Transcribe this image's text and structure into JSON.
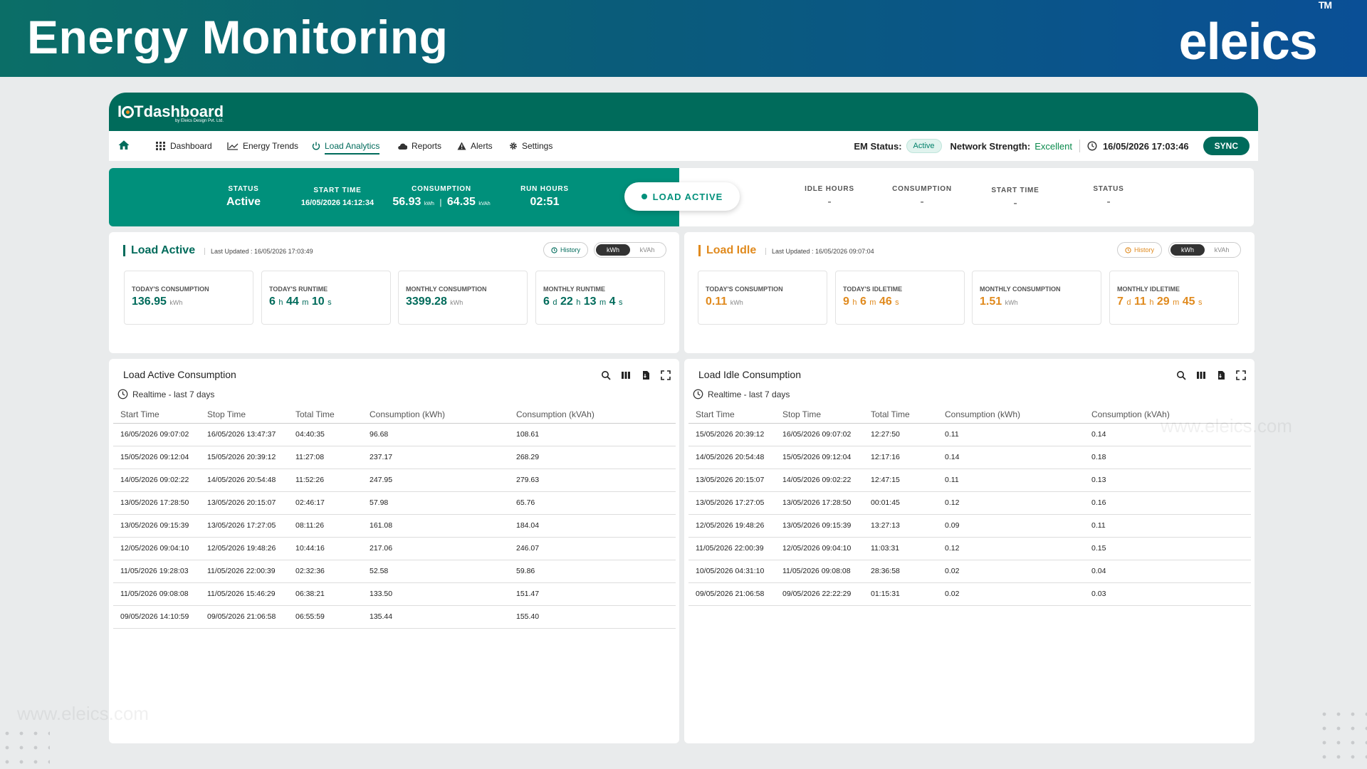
{
  "banner": {
    "title": "Energy Monitoring",
    "brand": "eleics",
    "brand_tm": "TM"
  },
  "app": {
    "logo_main": "Tdashboard",
    "logo_prefix": "I",
    "logo_sub": "by Eleics Design Pvt. Ltd."
  },
  "nav": {
    "items": [
      "Dashboard",
      "Energy Trends",
      "Load Analytics",
      "Reports",
      "Alerts",
      "Settings"
    ],
    "active": "Load Analytics",
    "em_status_label": "EM Status:",
    "em_status_value": "Active",
    "network_label": "Network Strength:",
    "network_value": "Excellent",
    "datetime": "16/05/2026 17:03:46",
    "sync": "SYNC"
  },
  "strip": {
    "active": {
      "status_k": "STATUS",
      "status_v": "Active",
      "start_k": "START TIME",
      "start_v": "16/05/2026 14:12:34",
      "cons_k": "CONSUMPTION",
      "cons_kwh": "56.93",
      "cons_kwh_unit": "kWh",
      "cons_sep": "|",
      "cons_kvah": "64.35",
      "cons_kvah_unit": "kVAh",
      "run_k": "RUN HOURS",
      "run_v": "02:51"
    },
    "load_active_btn": "LOAD ACTIVE",
    "idle": {
      "idle_k": "IDLE HOURS",
      "idle_v": "-",
      "cons_k": "CONSUMPTION",
      "cons_v": "-",
      "start_k": "START TIME",
      "start_v": "-",
      "status_k": "STATUS",
      "status_v": "-"
    }
  },
  "summary_active": {
    "title": "Load Active",
    "updated": "Last Updated : 16/05/2026 17:03:49",
    "history": "History",
    "unit_kwh": "kWh",
    "unit_kvah": "kVAh",
    "cards": [
      {
        "label": "TODAY'S CONSUMPTION",
        "value": "136.95",
        "unit": "kWh"
      },
      {
        "label": "TODAY'S RUNTIME",
        "d": "",
        "h": "6",
        "m": "44",
        "s": "10"
      },
      {
        "label": "MONTHLY CONSUMPTION",
        "value": "3399.28",
        "unit": "kWh"
      },
      {
        "label": "MONTHLY RUNTIME",
        "d": "6",
        "h": "22",
        "m": "13",
        "s": "4"
      }
    ]
  },
  "summary_idle": {
    "title": "Load Idle",
    "updated": "Last Updated : 16/05/2026 09:07:04",
    "history": "History",
    "unit_kwh": "kWh",
    "unit_kvah": "kVAh",
    "cards": [
      {
        "label": "TODAY'S CONSUMPTION",
        "value": "0.11",
        "unit": "kWh"
      },
      {
        "label": "TODAY'S IDLETIME",
        "d": "",
        "h": "9",
        "m": "6",
        "s": "46"
      },
      {
        "label": "MONTHLY CONSUMPTION",
        "value": "1.51",
        "unit": "kWh"
      },
      {
        "label": "MONTHLY IDLETIME",
        "d": "7",
        "h": "11",
        "m": "29",
        "s": "45"
      }
    ]
  },
  "units": {
    "d": "d",
    "h": "h",
    "m": "m",
    "s": "s"
  },
  "table_active": {
    "title": "Load Active Consumption",
    "subtitle": "Realtime - last 7 days",
    "headers": [
      "Start Time",
      "Stop Time",
      "Total Time",
      "Consumption (kWh)",
      "Consumption (kVAh)"
    ],
    "rows": [
      [
        "16/05/2026 09:07:02",
        "16/05/2026 13:47:37",
        "04:40:35",
        "96.68",
        "108.61"
      ],
      [
        "15/05/2026 09:12:04",
        "15/05/2026 20:39:12",
        "11:27:08",
        "237.17",
        "268.29"
      ],
      [
        "14/05/2026 09:02:22",
        "14/05/2026 20:54:48",
        "11:52:26",
        "247.95",
        "279.63"
      ],
      [
        "13/05/2026 17:28:50",
        "13/05/2026 20:15:07",
        "02:46:17",
        "57.98",
        "65.76"
      ],
      [
        "13/05/2026 09:15:39",
        "13/05/2026 17:27:05",
        "08:11:26",
        "161.08",
        "184.04"
      ],
      [
        "12/05/2026 09:04:10",
        "12/05/2026 19:48:26",
        "10:44:16",
        "217.06",
        "246.07"
      ],
      [
        "11/05/2026 19:28:03",
        "11/05/2026 22:00:39",
        "02:32:36",
        "52.58",
        "59.86"
      ],
      [
        "11/05/2026 09:08:08",
        "11/05/2026 15:46:29",
        "06:38:21",
        "133.50",
        "151.47"
      ],
      [
        "09/05/2026 14:10:59",
        "09/05/2026 21:06:58",
        "06:55:59",
        "135.44",
        "155.40"
      ]
    ]
  },
  "table_idle": {
    "title": "Load Idle Consumption",
    "subtitle": "Realtime - last 7 days",
    "headers": [
      "Start Time",
      "Stop Time",
      "Total Time",
      "Consumption (kWh)",
      "Consumption (kVAh)"
    ],
    "rows": [
      [
        "15/05/2026 20:39:12",
        "16/05/2026 09:07:02",
        "12:27:50",
        "0.11",
        "0.14"
      ],
      [
        "14/05/2026 20:54:48",
        "15/05/2026 09:12:04",
        "12:17:16",
        "0.14",
        "0.18"
      ],
      [
        "13/05/2026 20:15:07",
        "14/05/2026 09:02:22",
        "12:47:15",
        "0.11",
        "0.13"
      ],
      [
        "13/05/2026 17:27:05",
        "13/05/2026 17:28:50",
        "00:01:45",
        "0.12",
        "0.16"
      ],
      [
        "12/05/2026 19:48:26",
        "13/05/2026 09:15:39",
        "13:27:13",
        "0.09",
        "0.11"
      ],
      [
        "11/05/2026 22:00:39",
        "12/05/2026 09:04:10",
        "11:03:31",
        "0.12",
        "0.15"
      ],
      [
        "10/05/2026 04:31:10",
        "11/05/2026 09:08:08",
        "28:36:58",
        "0.02",
        "0.04"
      ],
      [
        "09/05/2026 21:06:58",
        "09/05/2026 22:22:29",
        "01:15:31",
        "0.02",
        "0.03"
      ]
    ]
  },
  "watermark": "www.eleics.com",
  "colors": {
    "teal": "#00907b",
    "dark_teal": "#006b5b",
    "orange": "#e08a1e"
  }
}
